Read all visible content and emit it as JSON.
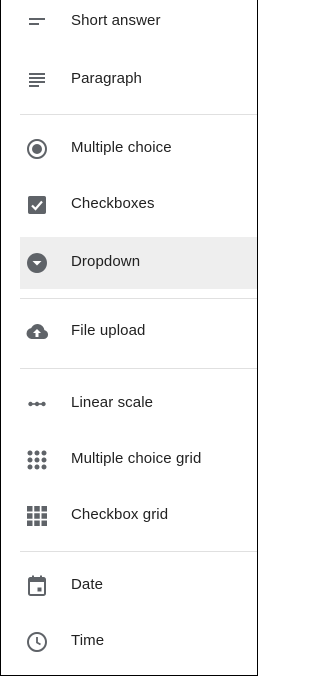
{
  "menu": {
    "items": [
      {
        "label": "Short answer",
        "icon": "short-text-icon"
      },
      {
        "label": "Paragraph",
        "icon": "paragraph-icon"
      },
      {
        "label": "Multiple choice",
        "icon": "radio-button-icon"
      },
      {
        "label": "Checkboxes",
        "icon": "checkbox-icon"
      },
      {
        "label": "Dropdown",
        "icon": "dropdown-icon",
        "selected": true
      },
      {
        "label": "File upload",
        "icon": "cloud-upload-icon"
      },
      {
        "label": "Linear scale",
        "icon": "linear-scale-icon"
      },
      {
        "label": "Multiple choice grid",
        "icon": "dot-grid-icon"
      },
      {
        "label": "Checkbox grid",
        "icon": "square-grid-icon"
      },
      {
        "label": "Date",
        "icon": "calendar-icon"
      },
      {
        "label": "Time",
        "icon": "clock-icon"
      }
    ]
  },
  "colors": {
    "icon": "#5f6368",
    "text": "#212121",
    "selected_bg": "#eeeeee",
    "divider": "#e0e0e0"
  }
}
